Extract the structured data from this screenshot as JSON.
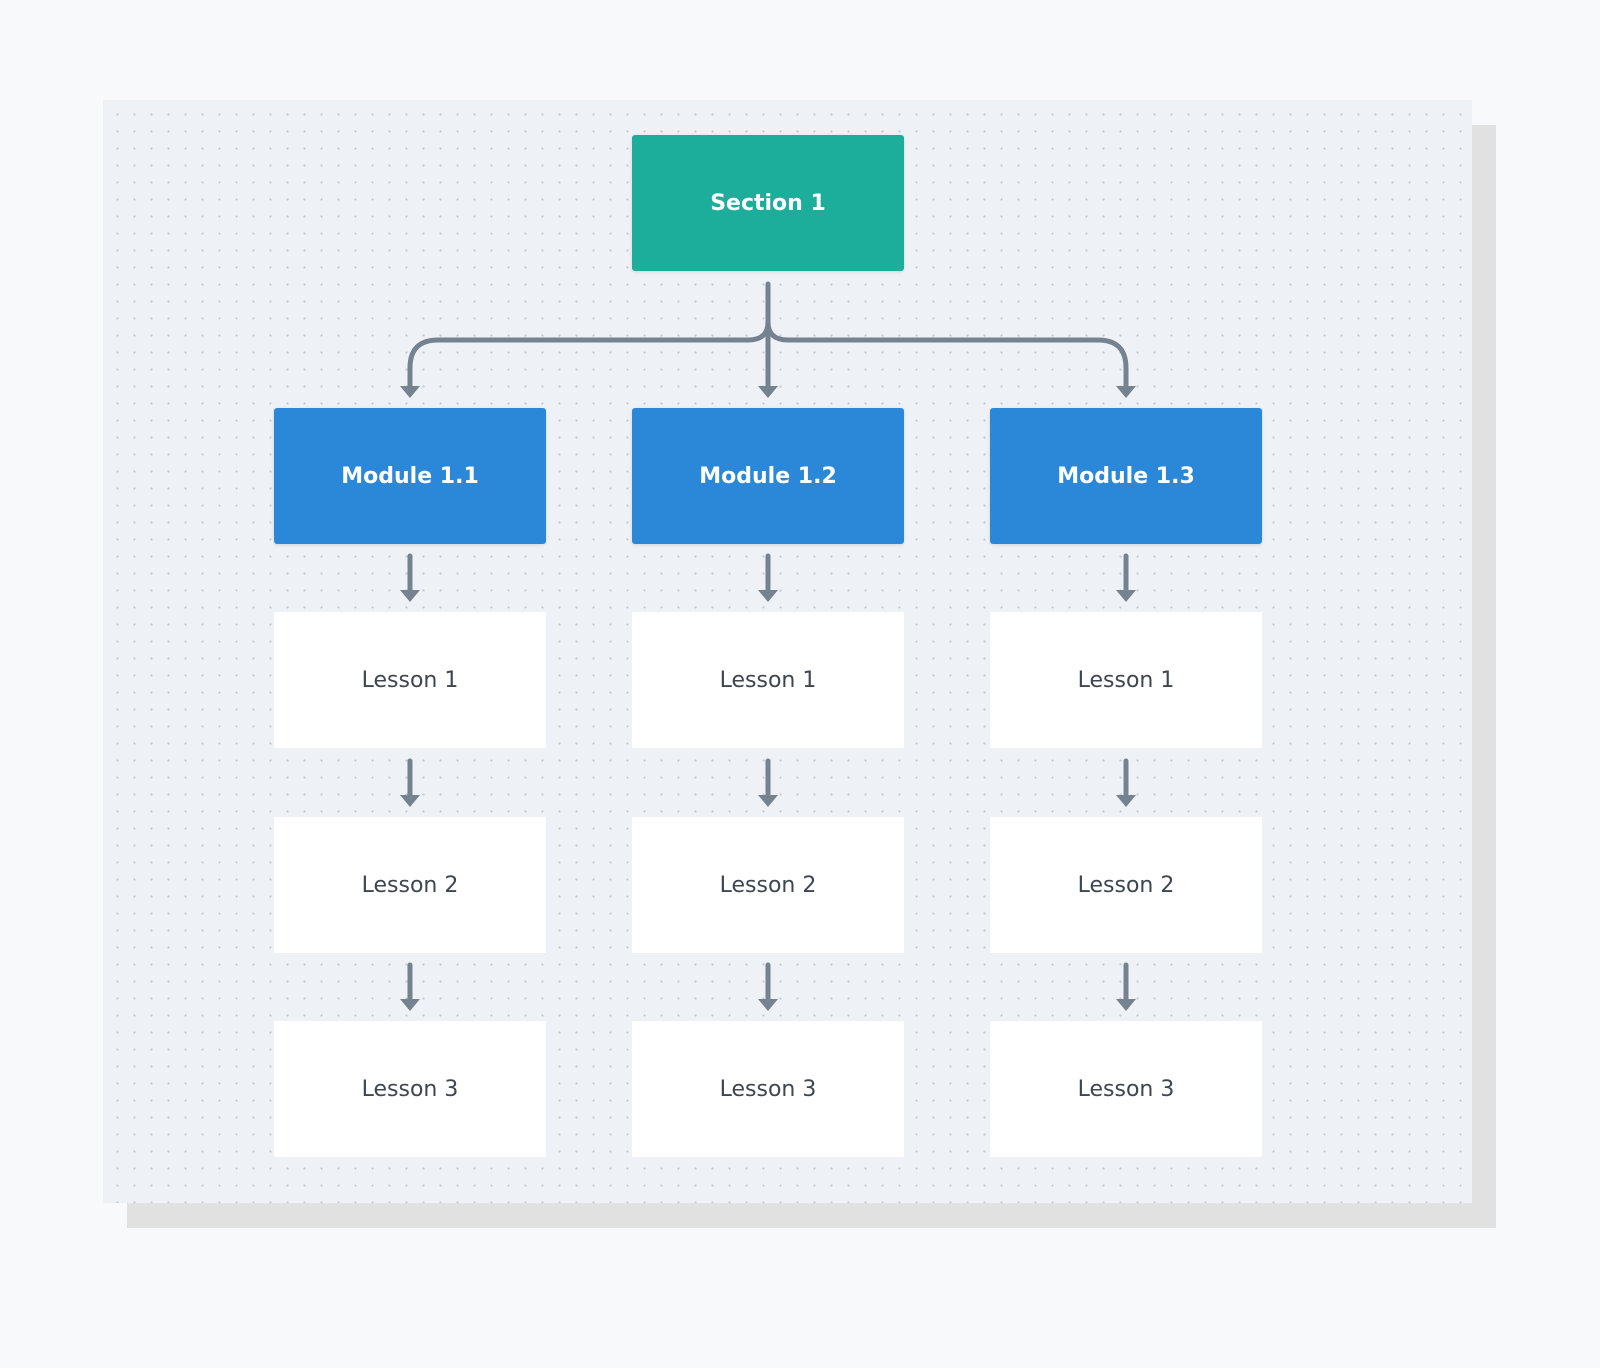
{
  "diagram": {
    "type": "hierarchy-tree",
    "colors": {
      "section": "#1cae9b",
      "module": "#2b88d9",
      "lesson": "#ffffff",
      "connector": "#75828f",
      "canvas": "#eef2f6"
    },
    "section": {
      "label": "Section 1"
    },
    "modules": [
      {
        "label": "Module 1.1",
        "lessons": [
          "Lesson 1",
          "Lesson 2",
          "Lesson 3"
        ]
      },
      {
        "label": "Module 1.2",
        "lessons": [
          "Lesson 1",
          "Lesson 2",
          "Lesson 3"
        ]
      },
      {
        "label": "Module 1.3",
        "lessons": [
          "Lesson 1",
          "Lesson 2",
          "Lesson 3"
        ]
      }
    ],
    "edges": [
      {
        "from": "Section 1",
        "to": "Module 1.1"
      },
      {
        "from": "Section 1",
        "to": "Module 1.2"
      },
      {
        "from": "Section 1",
        "to": "Module 1.3"
      },
      {
        "from": "Module 1.1",
        "to": "Lesson 1"
      },
      {
        "from": "Lesson 1",
        "to": "Lesson 2"
      },
      {
        "from": "Lesson 2",
        "to": "Lesson 3"
      },
      {
        "from": "Module 1.2",
        "to": "Lesson 1"
      },
      {
        "from": "Module 1.3",
        "to": "Lesson 1"
      }
    ]
  }
}
